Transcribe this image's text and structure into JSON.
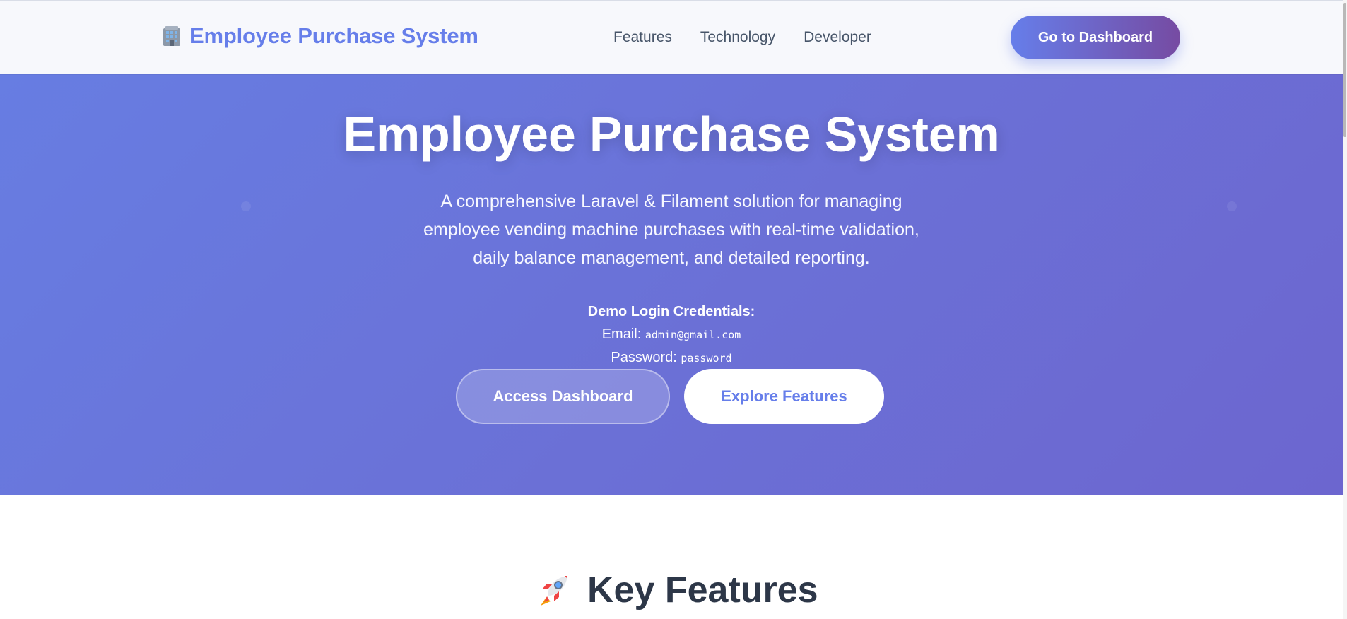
{
  "navbar": {
    "brand_icon": "office-building-icon",
    "brand_text": "Employee Purchase System",
    "links": [
      "Features",
      "Technology",
      "Developer"
    ],
    "cta_label": "Go to Dashboard"
  },
  "hero": {
    "title": "Employee Purchase System",
    "subtitle": "A comprehensive Laravel & Filament solution for managing employee vending machine purchases with real-time validation, daily balance management, and detailed reporting.",
    "credentials": {
      "title": "Demo Login Credentials:",
      "email_label": "Email:",
      "email_value": "admin@gmail.com",
      "password_label": "Password:",
      "password_value": "password"
    },
    "buttons": {
      "primary": "Access Dashboard",
      "secondary": "Explore Features"
    }
  },
  "features": {
    "icon": "rocket-icon",
    "title": "Key Features"
  },
  "colors": {
    "accent": "#667eea",
    "accent_end": "#764ba2",
    "hero_bg": "#6b70d6",
    "heading": "#2d3748"
  }
}
